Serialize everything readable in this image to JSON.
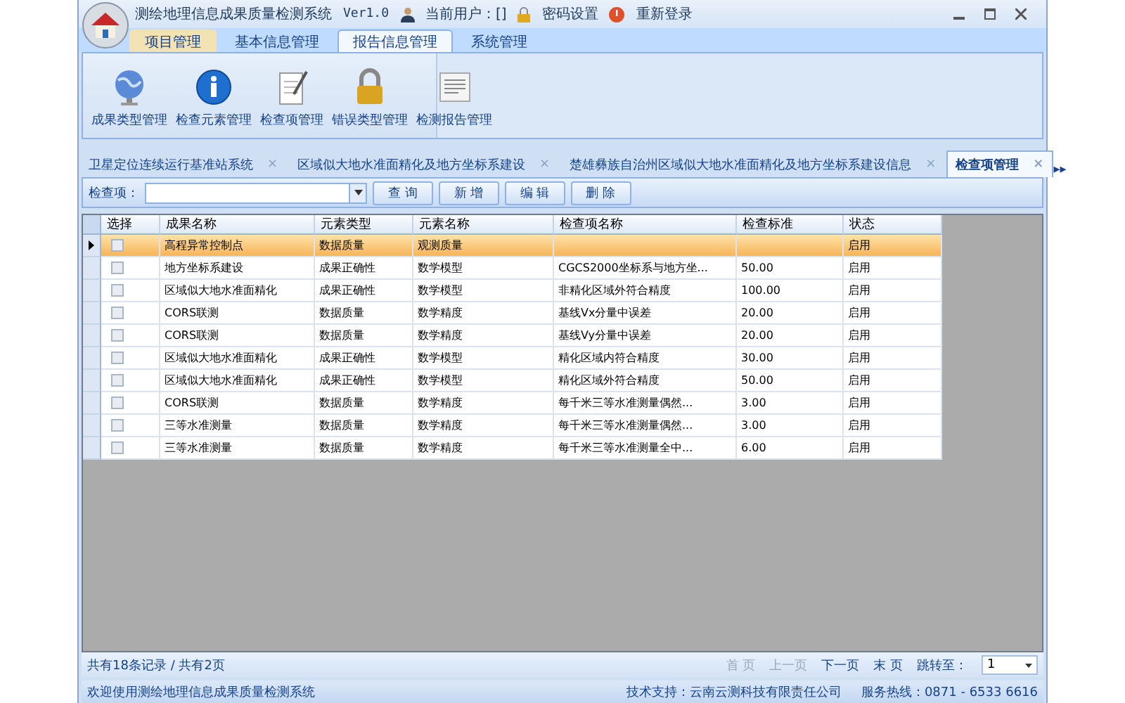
{
  "window": {
    "title": "测绘地理信息成果质量检测系统",
    "version": "Ver1.0",
    "user": "当前用户：[]",
    "links": [
      "密码设置",
      "重新登录"
    ]
  },
  "ribbon_tabs": [
    {
      "label": "项目管理",
      "selected": false,
      "highlighted": true
    },
    {
      "label": "基本信息管理",
      "selected": false,
      "highlighted": false
    },
    {
      "label": "报告信息管理",
      "selected": true,
      "highlighted": false
    },
    {
      "label": "系统管理",
      "selected": false,
      "highlighted": false
    }
  ],
  "ribbon_buttons": [
    {
      "label": "成果类型管理",
      "kind": "globe"
    },
    {
      "label": "检查元素管理",
      "kind": "info"
    },
    {
      "label": "检查项管理",
      "kind": "notepad"
    },
    {
      "label": "错误类型管理",
      "kind": "lock"
    },
    {
      "label": "检测报告管理",
      "kind": "document"
    }
  ],
  "doc_tabs": [
    {
      "label": "卫星定位连续运行基准站系统",
      "close": "×",
      "selected": false
    },
    {
      "label": "区域似大地水准面精化及地方坐标系建设",
      "close": "×",
      "selected": false
    },
    {
      "label": "楚雄彝族自治州区域似大地水准面精化及地方坐标系建设信息",
      "close": "×",
      "selected": false
    },
    {
      "label": "检查项管理",
      "close": "×",
      "selected": true
    }
  ],
  "doc_tabs_scroll": "▸▸",
  "toolbar": {
    "label": "检查项：",
    "buttons": [
      "查 询",
      "新 增",
      "编 辑",
      "删 除"
    ]
  },
  "table": {
    "select_column": "选择",
    "columns": [
      "成果名称",
      "元素类型",
      "元素名称",
      "检查项名称",
      "检查标准",
      "状态"
    ],
    "rows": [
      {
        "selected": true,
        "checked": false,
        "cells": [
          "高程异常控制点",
          "数据质量",
          "观测质量",
          "",
          "",
          "启用"
        ]
      },
      {
        "selected": false,
        "checked": false,
        "cells": [
          "地方坐标系建设",
          "成果正确性",
          "数学模型",
          "CGCS2000坐标系与地方坐...",
          "50.00",
          "启用"
        ]
      },
      {
        "selected": false,
        "checked": false,
        "cells": [
          "区域似大地水准面精化",
          "成果正确性",
          "数学模型",
          "非精化区域外符合精度",
          "100.00",
          "启用"
        ]
      },
      {
        "selected": false,
        "checked": false,
        "cells": [
          "CORS联测",
          "数据质量",
          "数学精度",
          "基线Vx分量中误差",
          "20.00",
          "启用"
        ]
      },
      {
        "selected": false,
        "checked": false,
        "cells": [
          "CORS联测",
          "数据质量",
          "数学精度",
          "基线Vy分量中误差",
          "20.00",
          "启用"
        ]
      },
      {
        "selected": false,
        "checked": false,
        "cells": [
          "区域似大地水准面精化",
          "成果正确性",
          "数学模型",
          "精化区域内符合精度",
          "30.00",
          "启用"
        ]
      },
      {
        "selected": false,
        "checked": false,
        "cells": [
          "区域似大地水准面精化",
          "成果正确性",
          "数学模型",
          "精化区域外符合精度",
          "50.00",
          "启用"
        ]
      },
      {
        "selected": false,
        "checked": false,
        "cells": [
          "CORS联测",
          "数据质量",
          "数学精度",
          "每千米三等水准测量偶然...",
          "3.00",
          "启用"
        ]
      },
      {
        "selected": false,
        "checked": false,
        "cells": [
          "三等水准测量",
          "数据质量",
          "数学精度",
          "每千米三等水准测量偶然...",
          "3.00",
          "启用"
        ]
      },
      {
        "selected": false,
        "checked": false,
        "cells": [
          "三等水准测量",
          "数据质量",
          "数学精度",
          "每千米三等水准测量全中...",
          "6.00",
          "启用"
        ]
      }
    ]
  },
  "pager": {
    "summary": "共有18条记录 / 共有2页",
    "links": [
      {
        "label": "首 页",
        "disabled": true
      },
      {
        "label": "上一页",
        "disabled": true
      },
      {
        "label": "下一页",
        "disabled": false
      },
      {
        "label": "末 页",
        "disabled": false
      }
    ],
    "jump_label": "跳转至：",
    "page": "1"
  },
  "status_bar": {
    "welcome": "欢迎使用测绘地理信息成果质量检测系统",
    "support": "技术支持：云南云测科技有限责任公司",
    "hotline": "服务热线：0871 - 6533 6616"
  }
}
